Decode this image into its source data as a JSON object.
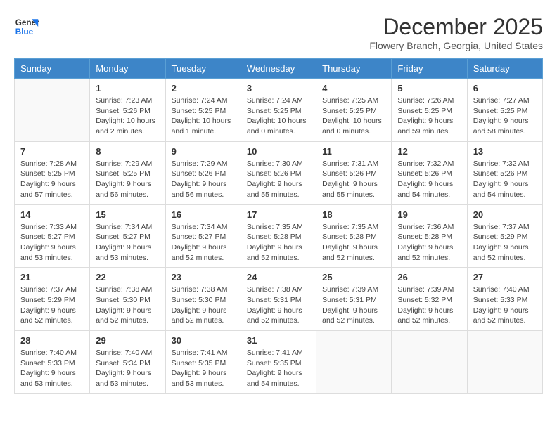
{
  "logo": {
    "line1": "General",
    "line2": "Blue"
  },
  "title": "December 2025",
  "location": "Flowery Branch, Georgia, United States",
  "days_of_week": [
    "Sunday",
    "Monday",
    "Tuesday",
    "Wednesday",
    "Thursday",
    "Friday",
    "Saturday"
  ],
  "weeks": [
    [
      {
        "day": "",
        "info": ""
      },
      {
        "day": "1",
        "info": "Sunrise: 7:23 AM\nSunset: 5:26 PM\nDaylight: 10 hours\nand 2 minutes."
      },
      {
        "day": "2",
        "info": "Sunrise: 7:24 AM\nSunset: 5:25 PM\nDaylight: 10 hours\nand 1 minute."
      },
      {
        "day": "3",
        "info": "Sunrise: 7:24 AM\nSunset: 5:25 PM\nDaylight: 10 hours\nand 0 minutes."
      },
      {
        "day": "4",
        "info": "Sunrise: 7:25 AM\nSunset: 5:25 PM\nDaylight: 10 hours\nand 0 minutes."
      },
      {
        "day": "5",
        "info": "Sunrise: 7:26 AM\nSunset: 5:25 PM\nDaylight: 9 hours\nand 59 minutes."
      },
      {
        "day": "6",
        "info": "Sunrise: 7:27 AM\nSunset: 5:25 PM\nDaylight: 9 hours\nand 58 minutes."
      }
    ],
    [
      {
        "day": "7",
        "info": "Sunrise: 7:28 AM\nSunset: 5:25 PM\nDaylight: 9 hours\nand 57 minutes."
      },
      {
        "day": "8",
        "info": "Sunrise: 7:29 AM\nSunset: 5:25 PM\nDaylight: 9 hours\nand 56 minutes."
      },
      {
        "day": "9",
        "info": "Sunrise: 7:29 AM\nSunset: 5:26 PM\nDaylight: 9 hours\nand 56 minutes."
      },
      {
        "day": "10",
        "info": "Sunrise: 7:30 AM\nSunset: 5:26 PM\nDaylight: 9 hours\nand 55 minutes."
      },
      {
        "day": "11",
        "info": "Sunrise: 7:31 AM\nSunset: 5:26 PM\nDaylight: 9 hours\nand 55 minutes."
      },
      {
        "day": "12",
        "info": "Sunrise: 7:32 AM\nSunset: 5:26 PM\nDaylight: 9 hours\nand 54 minutes."
      },
      {
        "day": "13",
        "info": "Sunrise: 7:32 AM\nSunset: 5:26 PM\nDaylight: 9 hours\nand 54 minutes."
      }
    ],
    [
      {
        "day": "14",
        "info": "Sunrise: 7:33 AM\nSunset: 5:27 PM\nDaylight: 9 hours\nand 53 minutes."
      },
      {
        "day": "15",
        "info": "Sunrise: 7:34 AM\nSunset: 5:27 PM\nDaylight: 9 hours\nand 53 minutes."
      },
      {
        "day": "16",
        "info": "Sunrise: 7:34 AM\nSunset: 5:27 PM\nDaylight: 9 hours\nand 52 minutes."
      },
      {
        "day": "17",
        "info": "Sunrise: 7:35 AM\nSunset: 5:28 PM\nDaylight: 9 hours\nand 52 minutes."
      },
      {
        "day": "18",
        "info": "Sunrise: 7:35 AM\nSunset: 5:28 PM\nDaylight: 9 hours\nand 52 minutes."
      },
      {
        "day": "19",
        "info": "Sunrise: 7:36 AM\nSunset: 5:28 PM\nDaylight: 9 hours\nand 52 minutes."
      },
      {
        "day": "20",
        "info": "Sunrise: 7:37 AM\nSunset: 5:29 PM\nDaylight: 9 hours\nand 52 minutes."
      }
    ],
    [
      {
        "day": "21",
        "info": "Sunrise: 7:37 AM\nSunset: 5:29 PM\nDaylight: 9 hours\nand 52 minutes."
      },
      {
        "day": "22",
        "info": "Sunrise: 7:38 AM\nSunset: 5:30 PM\nDaylight: 9 hours\nand 52 minutes."
      },
      {
        "day": "23",
        "info": "Sunrise: 7:38 AM\nSunset: 5:30 PM\nDaylight: 9 hours\nand 52 minutes."
      },
      {
        "day": "24",
        "info": "Sunrise: 7:38 AM\nSunset: 5:31 PM\nDaylight: 9 hours\nand 52 minutes."
      },
      {
        "day": "25",
        "info": "Sunrise: 7:39 AM\nSunset: 5:31 PM\nDaylight: 9 hours\nand 52 minutes."
      },
      {
        "day": "26",
        "info": "Sunrise: 7:39 AM\nSunset: 5:32 PM\nDaylight: 9 hours\nand 52 minutes."
      },
      {
        "day": "27",
        "info": "Sunrise: 7:40 AM\nSunset: 5:33 PM\nDaylight: 9 hours\nand 52 minutes."
      }
    ],
    [
      {
        "day": "28",
        "info": "Sunrise: 7:40 AM\nSunset: 5:33 PM\nDaylight: 9 hours\nand 53 minutes."
      },
      {
        "day": "29",
        "info": "Sunrise: 7:40 AM\nSunset: 5:34 PM\nDaylight: 9 hours\nand 53 minutes."
      },
      {
        "day": "30",
        "info": "Sunrise: 7:41 AM\nSunset: 5:35 PM\nDaylight: 9 hours\nand 53 minutes."
      },
      {
        "day": "31",
        "info": "Sunrise: 7:41 AM\nSunset: 5:35 PM\nDaylight: 9 hours\nand 54 minutes."
      },
      {
        "day": "",
        "info": ""
      },
      {
        "day": "",
        "info": ""
      },
      {
        "day": "",
        "info": ""
      }
    ]
  ]
}
